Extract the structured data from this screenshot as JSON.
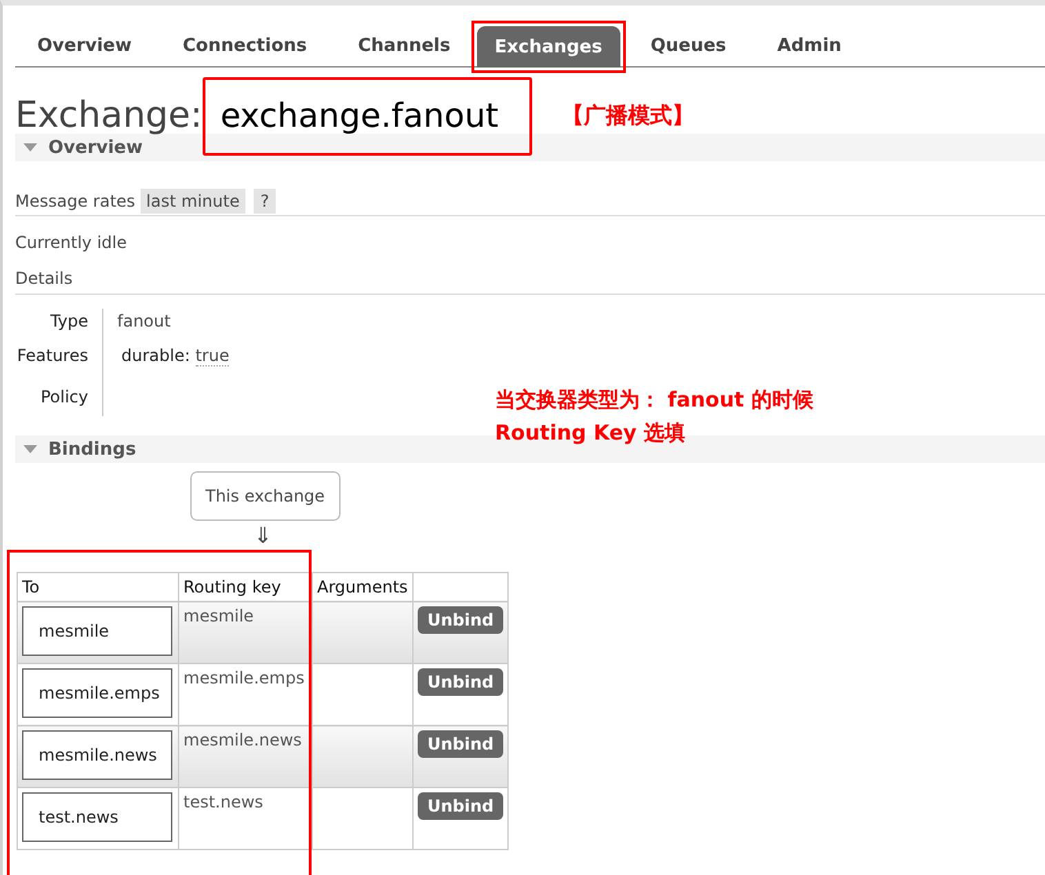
{
  "nav": {
    "tabs": [
      {
        "label": "Overview",
        "selected": false,
        "highlighted": false
      },
      {
        "label": "Connections",
        "selected": false,
        "highlighted": false
      },
      {
        "label": "Channels",
        "selected": false,
        "highlighted": false
      },
      {
        "label": "Exchanges",
        "selected": true,
        "highlighted": true
      },
      {
        "label": "Queues",
        "selected": false,
        "highlighted": false
      },
      {
        "label": "Admin",
        "selected": false,
        "highlighted": false
      }
    ]
  },
  "title": {
    "prefix": "Exchange:",
    "name": "exchange.fanout",
    "highlighted": true
  },
  "annotations": {
    "title_note": "【广播模式】",
    "note_lines": [
      "当交换器类型为： fanout 的时候",
      "Routing Key 选填"
    ]
  },
  "overview": {
    "heading": "Overview",
    "message_rates": {
      "label": "Message rates",
      "period": "last minute",
      "help": "?"
    },
    "status": "Currently idle",
    "details_heading": "Details",
    "details": [
      {
        "label": "Type",
        "value": "fanout"
      },
      {
        "label": "Features",
        "key": "durable:",
        "value": "true"
      },
      {
        "label": "Policy"
      }
    ]
  },
  "bindings": {
    "heading": "Bindings",
    "source": "This exchange",
    "arrow": "⇓",
    "highlighted": true,
    "columns": [
      "To",
      "Routing key",
      "Arguments"
    ],
    "rows": [
      {
        "to": "mesmile",
        "routing_key": "mesmile",
        "action": "Unbind"
      },
      {
        "to": "mesmile.emps",
        "routing_key": "mesmile.emps",
        "action": "Unbind"
      },
      {
        "to": "mesmile.news",
        "routing_key": "mesmile.news",
        "action": "Unbind"
      },
      {
        "to": "test.news",
        "routing_key": "test.news",
        "action": "Unbind"
      }
    ]
  }
}
